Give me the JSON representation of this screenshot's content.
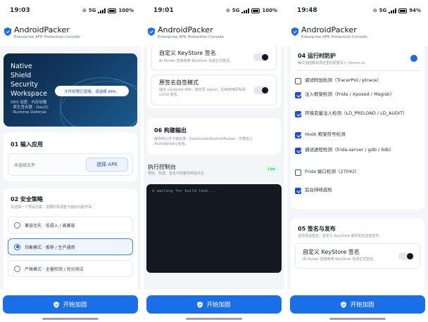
{
  "common": {
    "app_title": "AndroidPacker",
    "app_subtitle": "Enterprise APK Protection Console",
    "cta_label": "开始加固",
    "brand_color": "#1a6fe8"
  },
  "screens": [
    {
      "time": "19:03",
      "network": "5G",
      "battery": "100%"
    },
    {
      "time": "19:01",
      "network": "5G",
      "battery": "100%"
    },
    {
      "time": "19:48",
      "network": "5G",
      "battery": "94%"
    }
  ],
  "screen1": {
    "hero_lines": [
      "Native",
      "Shield",
      "Security",
      "Workspace"
    ],
    "hero_meta": [
      "DEX 加密 · 内存加载",
      "· 原生签名器 · Dex2C",
      "· Runtime Defense"
    ],
    "pick_pill": "文件权限已就绪，请选择 APK。",
    "input_title": "01  输入应用",
    "input_placeholder": "未选择文件",
    "select_apk": "选择 APK",
    "strategy_title": "02  安全策略",
    "strategy_sub": "先选择一个预设方案，需要时再调整下面的功能开关。",
    "options": [
      {
        "label": "兼容优先 · 低侵入 / 高兼容",
        "selected": false
      },
      {
        "label": "均衡模式 · 推荐 / 生产通用",
        "selected": true
      },
      {
        "label": "严格模式 · 全量检测 / 充分测试",
        "selected": false
      }
    ]
  },
  "screen2": {
    "custom_ks_title": "自定义 KeyStore 签名",
    "custom_ks_sub": "由 Packer 直接使用 KeyStore 完成正式签名。",
    "self_sign_title": "原签名自签模式",
    "self_sign_sub": "输出 unsigned APK，锁定原 signer，后续使用原私钥 v2/v3 签名。",
    "output_title": "06  构建输出",
    "output_sub": "保存到公共下载目录：Downloads/AndroidPacker，不再放入 Android/data/包名。",
    "console_title": "执行控制台",
    "console_sub": "预检、构建、签名与完整性校验日志",
    "console_badge": "Live",
    "console_line": "$ waiting for build task..."
  },
  "screen3": {
    "runtime_title": "04  运行时防护",
    "runtime_sub": "每次加固都会把这里的配置写入 libcore.so",
    "checks": [
      {
        "label": "调试附加检测（TracerPid / ptrace）",
        "checked": false
      },
      {
        "label": "注入框架检测（Frida / Xposed / Magisk）",
        "checked": true
      },
      {
        "label": "环境变量注入检测（LD_PRELOAD / LD_AUDIT）",
        "checked": true
      },
      {
        "label": "Hook 框架符号检测",
        "checked": true
      },
      {
        "label": "调试进程检测（frida-server / gdb / lldb）",
        "checked": true
      },
      {
        "label": "Frida 端口检测（27042）",
        "checked": false
      },
      {
        "label": "后台持续巡检",
        "checked": true
      }
    ],
    "sign_title": "05  签名与发布",
    "sign_sub": "选择测试签名、自定义 KeyStore 或原签名自签发布。",
    "custom_ks_title": "自定义 KeyStore 签名",
    "custom_ks_sub": "由 Packer 直接使用 KeyStore 完成正式签名。"
  }
}
